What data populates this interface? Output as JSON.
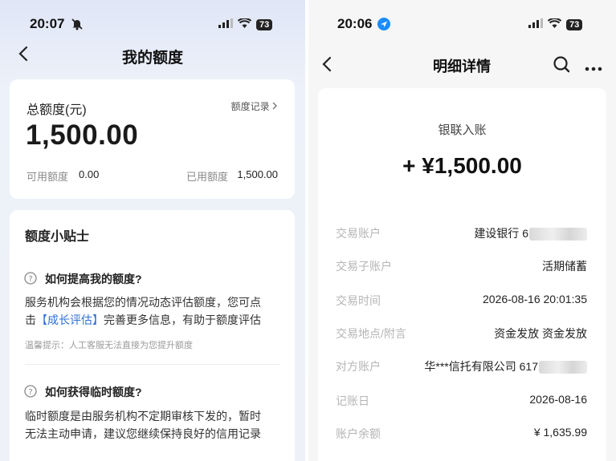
{
  "left": {
    "status": {
      "time": "20:07",
      "battery": "73"
    },
    "nav": {
      "title": "我的额度"
    },
    "quota_card": {
      "title": "总额度(元)",
      "record_link": "额度记录",
      "amount": "1,500.00",
      "available_label": "可用额度",
      "available_value": "0.00",
      "used_label": "已用额度",
      "used_value": "1,500.00"
    },
    "tips": {
      "title": "额度小贴士",
      "q1": {
        "question": "如何提高我的额度?",
        "line1": "服务机构会根据您的情况动态评估额度，您可点",
        "line2_prefix": "击",
        "line2_link": "【成长评估】",
        "line2_suffix": "完善更多信息，有助于额度评估",
        "note": "温馨提示：人工客服无法直接为您提升额度"
      },
      "q2": {
        "question": "如何获得临时额度?",
        "line1": "临时额度是由服务机构不定期审核下发的，暂时",
        "line2": "无法主动申请，建议您继续保持良好的信用记录"
      }
    }
  },
  "right": {
    "status": {
      "time": "20:06",
      "battery": "73"
    },
    "nav": {
      "title": "明细详情"
    },
    "detail": {
      "type": "银联入账",
      "amount": "+ ¥1,500.00",
      "rows": [
        {
          "label": "交易账户",
          "value": "建设银行 6"
        },
        {
          "label": "交易子账户",
          "value": "活期储蓄"
        },
        {
          "label": "交易时间",
          "value": "2026-08-16 20:01:35"
        },
        {
          "label": "交易地点/附言",
          "value": "资金发放 资金发放"
        },
        {
          "label": "对方账户",
          "value": "华***信托有限公司 617"
        },
        {
          "label": "记账日",
          "value": "2026-08-16"
        },
        {
          "label": "账户余额",
          "value": "¥ 1,635.99"
        }
      ]
    }
  }
}
